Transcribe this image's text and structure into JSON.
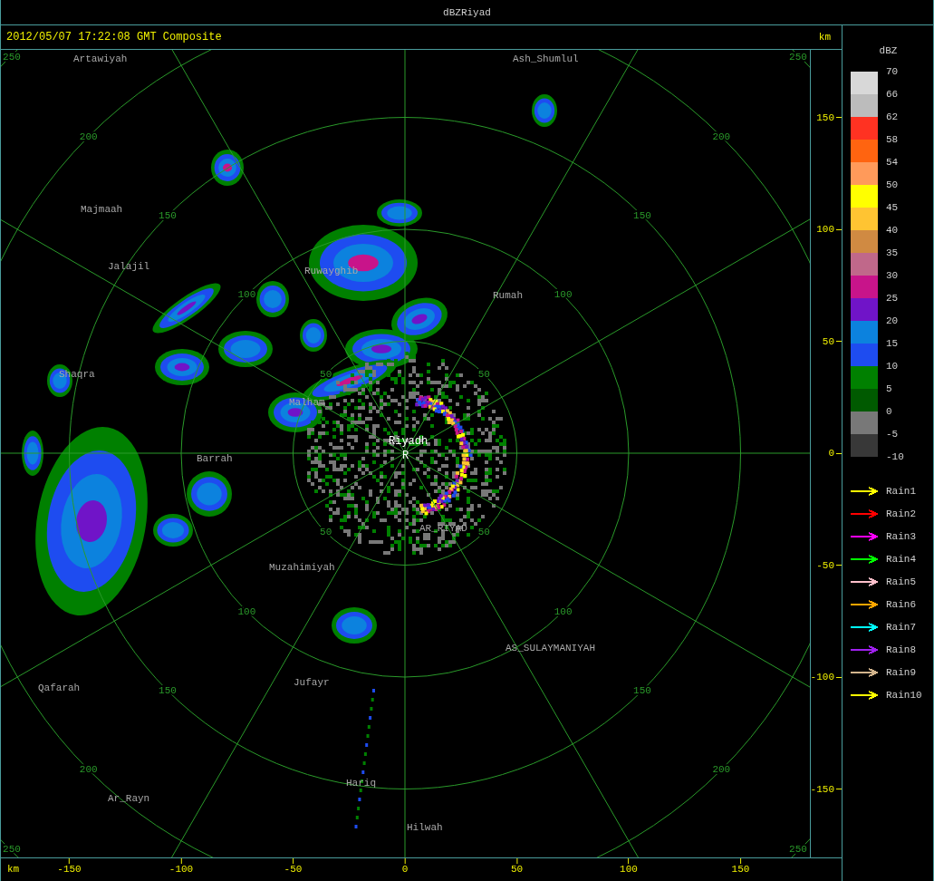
{
  "window": {
    "title": "dBZRiyad"
  },
  "header": {
    "timestamp": "2012/05/07 17:22:08 GMT Composite"
  },
  "map": {
    "places": [
      {
        "name": "Artawiyah",
        "kind": "town"
      },
      {
        "name": "Ash_Shumlul",
        "kind": "town"
      },
      {
        "name": "Majmaah",
        "kind": "town"
      },
      {
        "name": "Jalajil",
        "kind": "town"
      },
      {
        "name": "Ruwayghib",
        "kind": "town"
      },
      {
        "name": "Rumah",
        "kind": "town"
      },
      {
        "name": "Shaqra",
        "kind": "town"
      },
      {
        "name": "Malham",
        "kind": "town"
      },
      {
        "name": "Riyadh",
        "kind": "site"
      },
      {
        "name": "R",
        "kind": "site"
      },
      {
        "name": "Barrah",
        "kind": "town"
      },
      {
        "name": "AR_RIYAD",
        "kind": "town"
      },
      {
        "name": "Muzahimiyah",
        "kind": "town"
      },
      {
        "name": "AS_SULAYMANIYAH",
        "kind": "town"
      },
      {
        "name": "Qafarah",
        "kind": "town"
      },
      {
        "name": "Jufayr",
        "kind": "town"
      },
      {
        "name": "Hariq",
        "kind": "town"
      },
      {
        "name": "Ar_Rayn",
        "kind": "town"
      },
      {
        "name": "Hilwah",
        "kind": "town"
      }
    ],
    "range_rings": [
      {
        "labels": [
          "50",
          "50",
          "50",
          "50"
        ]
      },
      {
        "labels": [
          "100",
          "100",
          "100",
          "100"
        ]
      },
      {
        "labels": [
          "150",
          "150",
          "150",
          "150"
        ]
      },
      {
        "labels": [
          "200",
          "200",
          "200",
          "200"
        ]
      },
      {
        "labels": [
          "250",
          "250",
          "250",
          "250"
        ]
      }
    ]
  },
  "y_axis": {
    "unit": "km",
    "ticks": [
      "150",
      "100",
      "50",
      "0",
      "-50",
      "-100",
      "-150"
    ]
  },
  "x_axis": {
    "unit": "km",
    "ticks": [
      "-150",
      "-100",
      "-50",
      "0",
      "50",
      "100",
      "150"
    ]
  },
  "legend": {
    "title": "dBZ",
    "scale": [
      "70",
      "66",
      "62",
      "58",
      "54",
      "50",
      "45",
      "40",
      "35",
      "30",
      "25",
      "20",
      "15",
      "10",
      "5",
      "0",
      "-5",
      "-10"
    ],
    "bands": [
      {
        "color": "#d8d8d8"
      },
      {
        "color": "#bcbcbc"
      },
      {
        "color": "#ff3222"
      },
      {
        "color": "#ff6410"
      },
      {
        "color": "#ff9a5a"
      },
      {
        "color": "#ffff00"
      },
      {
        "color": "#ffc432"
      },
      {
        "color": "#d08a42"
      },
      {
        "color": "#c0688a"
      },
      {
        "color": "#c8148a"
      },
      {
        "color": "#7014c8"
      },
      {
        "color": "#0c82de"
      },
      {
        "color": "#1e4cf0"
      },
      {
        "color": "#008000"
      },
      {
        "color": "#005a00"
      },
      {
        "color": "#787878"
      },
      {
        "color": "#383838"
      }
    ],
    "tracks": [
      {
        "label": "Rain1",
        "color": "#ffff00"
      },
      {
        "label": "Rain2",
        "color": "#ff0000"
      },
      {
        "label": "Rain3",
        "color": "#ff00ff"
      },
      {
        "label": "Rain4",
        "color": "#00ff00"
      },
      {
        "label": "Rain5",
        "color": "#ffc0cb"
      },
      {
        "label": "Rain6",
        "color": "#ffa500"
      },
      {
        "label": "Rain7",
        "color": "#00ffff"
      },
      {
        "label": "Rain8",
        "color": "#a020f0"
      },
      {
        "label": "Rain9",
        "color": "#d2b48c"
      },
      {
        "label": "Rain10",
        "color": "#ffff00"
      }
    ]
  }
}
